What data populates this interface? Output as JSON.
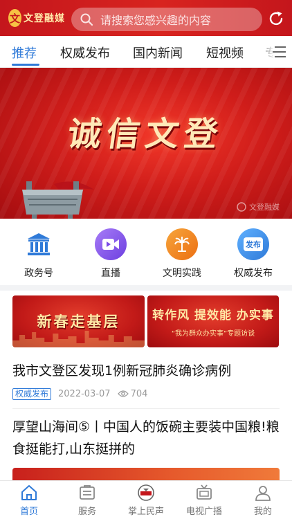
{
  "colors": {
    "brand_red": "#c4161c",
    "accent_blue": "#2f7ad8"
  },
  "header": {
    "logo_mark": "文",
    "logo_text": "文登融媒",
    "search_placeholder": "请搜索您感兴趣的内容",
    "search_icon": "search-icon",
    "refresh_icon": "refresh-icon"
  },
  "tabs": {
    "items": [
      "推荐",
      "权威发布",
      "国内新闻",
      "短视频",
      "专"
    ],
    "active": "推荐",
    "menu_icon": "menu-icon"
  },
  "hero": {
    "title": "诚信文登",
    "watermark": "文登融媒"
  },
  "quick_entries": [
    {
      "label": "政务号",
      "icon": "government-building-icon",
      "color": "#2f7ad8"
    },
    {
      "label": "直播",
      "icon": "live-video-icon",
      "color": "#8b5cf6"
    },
    {
      "label": "文明实践",
      "icon": "civilization-practice-icon",
      "color": "#f08a1c"
    },
    {
      "label": "权威发布",
      "icon": "release-badge-icon",
      "color": "#2f8cf0",
      "badge_text": "发布"
    }
  ],
  "promos": [
    {
      "title": "新春走基层"
    },
    {
      "title": "转作风 提效能 办实事",
      "subtitle": "“我为群众办实事”专题访谈"
    }
  ],
  "news": [
    {
      "title": "我市文登区发现1例新冠肺炎确诊病例",
      "tag": "权威发布",
      "date": "2022-03-07",
      "views": "704"
    },
    {
      "title": "厚望山海间⑤丨中国人的饭碗主要装中国粮!粮食挺能打,山东挺拼的"
    }
  ],
  "bottom_nav": [
    {
      "label": "首页",
      "icon": "home-icon",
      "active": true
    },
    {
      "label": "服务",
      "icon": "service-icon",
      "active": false
    },
    {
      "label": "掌上民声",
      "icon": "public-voice-icon",
      "active": false
    },
    {
      "label": "电视广播",
      "icon": "tv-icon",
      "active": false
    },
    {
      "label": "我的",
      "icon": "profile-icon",
      "active": false
    }
  ]
}
